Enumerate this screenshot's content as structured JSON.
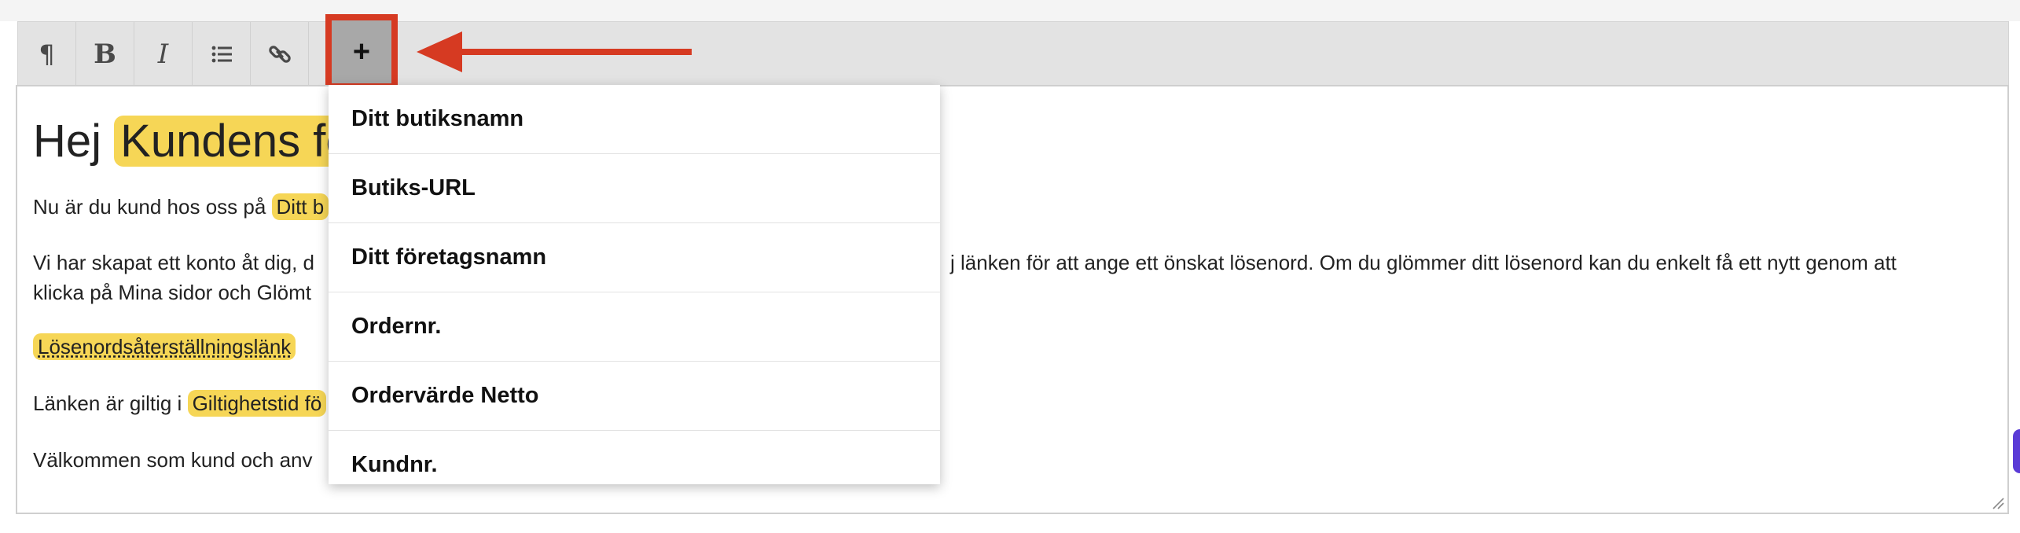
{
  "toolbar": {
    "buttons": [
      {
        "name": "paragraph",
        "label": "¶"
      },
      {
        "name": "bold",
        "label": "B"
      },
      {
        "name": "italic",
        "label": "I"
      },
      {
        "name": "bullet-list",
        "label": ""
      },
      {
        "name": "link",
        "label": ""
      }
    ],
    "insert_label": "+"
  },
  "editor": {
    "heading_prefix": "Hej ",
    "heading_placeholder": "Kundens fö",
    "p1_prefix": "Nu är du kund hos oss på ",
    "p1_placeholder": "Ditt b",
    "p2_line1_left": "Vi har skapat ett konto åt dig, d",
    "p2_line1_right": "j länken för att ange ett önskat lösenord. Om du glömmer ditt lösenord kan du enkelt få ett nytt genom att",
    "p2_line2": "klicka på Mina sidor och Glömt",
    "reset_link": "Lösenordsåterställningslänk",
    "p3_prefix": "Länken är giltig i ",
    "p3_placeholder": "Giltighetstid fö",
    "p4": "Välkommen som kund och anv"
  },
  "dropdown": {
    "items": [
      "Ditt butiksnamn",
      "Butiks-URL",
      "Ditt företagsnamn",
      "Ordernr.",
      "Ordervärde Netto",
      "Kundnr."
    ]
  },
  "colors": {
    "highlight": "#f6d656",
    "annotation": "#d63a22",
    "toolbar_bg": "#e3e3e3",
    "active_button": "#a8a8a8"
  }
}
